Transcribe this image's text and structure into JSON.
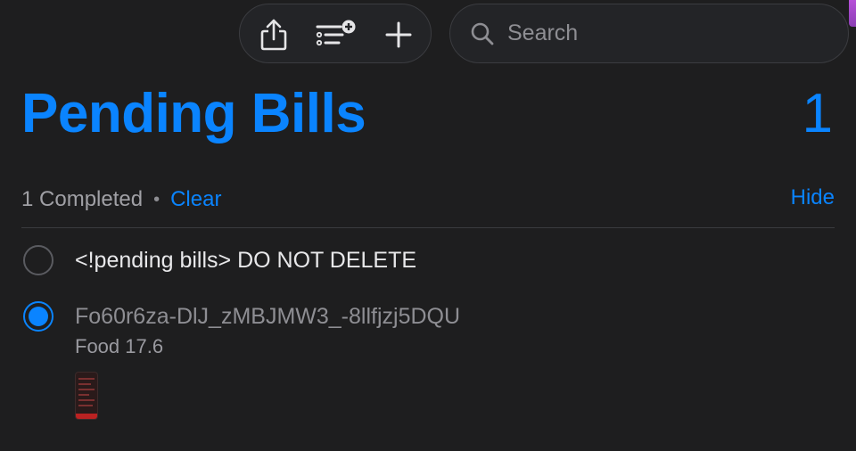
{
  "toolbar": {
    "share_icon": "share-icon",
    "list_icon": "list-add-icon",
    "add_icon": "plus-icon"
  },
  "search": {
    "placeholder": "Search",
    "value": ""
  },
  "header": {
    "title": "Pending Bills",
    "count": "1"
  },
  "completed": {
    "text": "1 Completed",
    "separator": "•",
    "clear_label": "Clear",
    "hide_label": "Hide"
  },
  "reminders": [
    {
      "title": "<!pending bills> DO NOT DELETE",
      "notes": "",
      "completed": false,
      "has_attachment": false
    },
    {
      "title": "Fo60r6za-DlJ_zMBJMW3_-8llfjzj5DQU",
      "notes": "Food 17.6",
      "completed": true,
      "has_attachment": true
    }
  ],
  "colors": {
    "accent": "#0a84ff",
    "background": "#1e1e1f",
    "muted_text": "#8e8e93"
  }
}
